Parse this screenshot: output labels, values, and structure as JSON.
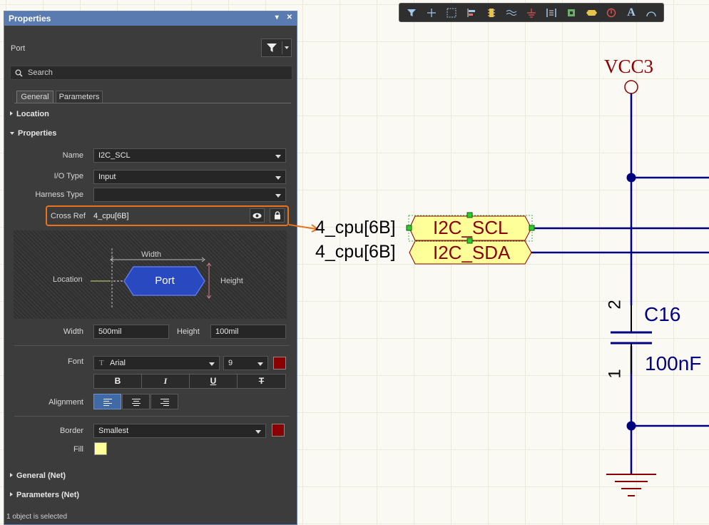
{
  "panel": {
    "title": "Properties",
    "pin_glyph": "▾",
    "close_glyph": "✕",
    "object_type": "Port",
    "search_placeholder": "Search",
    "tabs": [
      "General",
      "Parameters"
    ],
    "sections": {
      "location": "Location",
      "properties": "Properties",
      "general_net": "General (Net)",
      "parameters_net": "Parameters (Net)"
    },
    "fields": {
      "name_label": "Name",
      "name_value": "I2C_SCL",
      "io_label": "I/O Type",
      "io_value": "Input",
      "harness_label": "Harness Type",
      "harness_value": "",
      "crossref_label": "Cross Ref",
      "crossref_value": "4_cpu[6B]",
      "width_label": "Width",
      "width_value": "500mil",
      "height_label": "Height",
      "height_value": "100mil",
      "font_label": "Font",
      "font_value": "Arial",
      "font_size": "9",
      "alignment_label": "Alignment",
      "border_label": "Border",
      "border_value": "Smallest",
      "fill_label": "Fill"
    },
    "preview": {
      "width_label": "Width",
      "height_label": "Height",
      "location_label": "Location",
      "port_label": "Port"
    },
    "format_buttons": [
      "B",
      "I",
      "U",
      "T"
    ],
    "status": "1 object is selected",
    "colors": {
      "font_color": "#8b0000",
      "border_color": "#8b0000",
      "fill_color": "#ffff99",
      "highlight": "#e8731c"
    }
  },
  "toolbar": {
    "icons": [
      "filter-icon",
      "cross-icon",
      "select-rect-icon",
      "align-icon",
      "component-icon",
      "bus-icon",
      "ground-power-icon",
      "harness-icon",
      "part-icon",
      "port-icon",
      "no-erc-icon",
      "text-icon",
      "arc-icon"
    ],
    "text_glyph": "A"
  },
  "schematic": {
    "power_label": "VCC3",
    "port1_name": "I2C_SCL",
    "port2_name": "I2C_SDA",
    "crossref1": "4_cpu[6B]",
    "crossref2": "4_cpu[6B]",
    "cap_designator": "C16",
    "cap_value": "100nF",
    "pin_top": "2",
    "pin_bottom": "1",
    "colors": {
      "wire": "#000080",
      "power": "#8b0000",
      "port_fill": "#ffff99",
      "port_text": "#8b0000"
    }
  }
}
